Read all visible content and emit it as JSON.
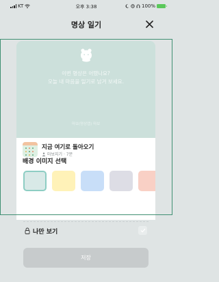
{
  "status_bar": {
    "carrier": "KT",
    "time": "오후 3:38",
    "battery": "100%"
  },
  "header": {
    "title": "명상 일기"
  },
  "preview": {
    "prompt_line1": "이번 명상은 어땠나요?",
    "prompt_line2": "오늘 내 마음을 일기로 남겨 보세요.",
    "credit": "마보(명상앱) 마보"
  },
  "track": {
    "title": "지금 여기로 돌아오기",
    "meta": "마보지기 · 7분"
  },
  "background": {
    "label": "배경 이미지 선택",
    "swatch_colors": [
      "#d8e9e7",
      "#fff2b8",
      "#c8def8",
      "#dddde5",
      "#f9d0c5"
    ]
  },
  "privacy": {
    "label": "나만 보기"
  },
  "actions": {
    "save_label": "저장"
  },
  "colors": {
    "preview_bg": "#cce0db",
    "accent_outline": "#3f8f72",
    "disabled_button": "#c7cbcc"
  },
  "icons": [
    "wifi-icon",
    "close-icon",
    "mascot-icon",
    "person-icon",
    "lock-icon",
    "checkbox"
  ]
}
